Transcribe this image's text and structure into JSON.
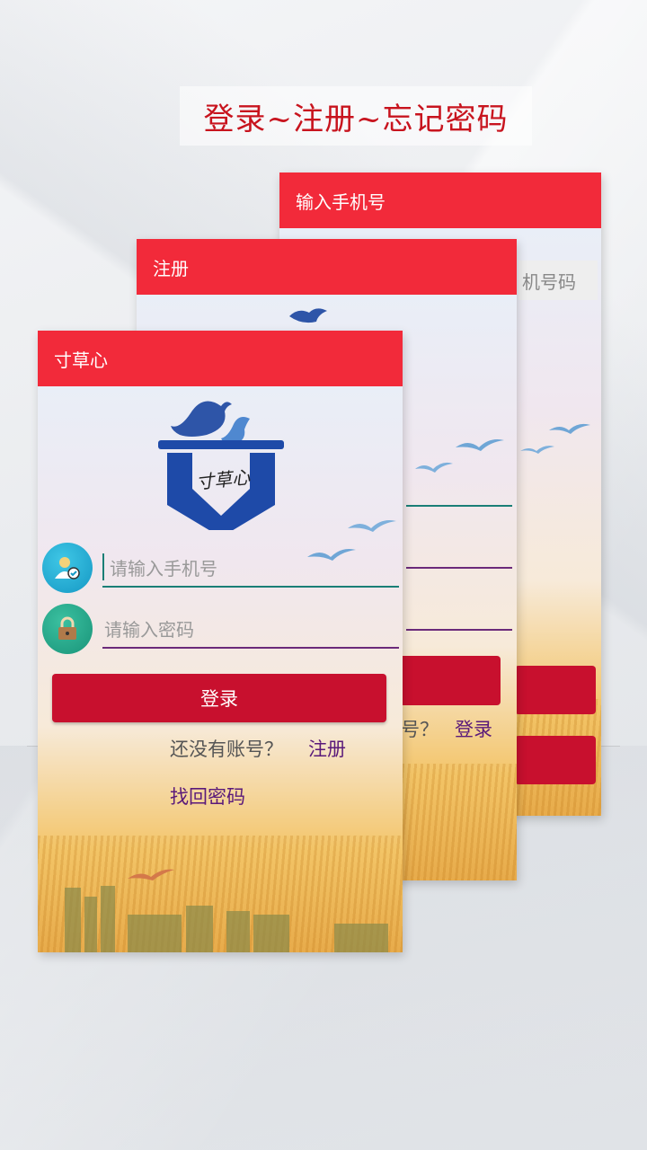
{
  "headline": "登录~注册~忘记密码",
  "back_screen": {
    "title": "输入手机号",
    "field_partial": "机号码"
  },
  "middle_screen": {
    "title": "注册",
    "question_partial": "号？",
    "login_link": "登录"
  },
  "front_screen": {
    "title": "寸草心",
    "logo_text": "寸草心",
    "phone_placeholder": "请输入手机号",
    "password_placeholder": "请输入密码",
    "login_button": "登录",
    "no_account_text": "还没有账号？",
    "register_link": "注册",
    "forgot_password_link": "找回密码"
  },
  "colors": {
    "app_bar": "#f22a3a",
    "button": "#c8102e",
    "headline": "#c8141e",
    "link": "#5a1a7a"
  }
}
